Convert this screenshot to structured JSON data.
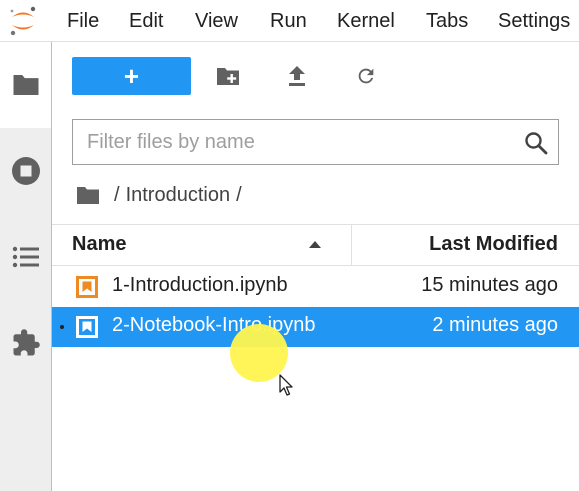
{
  "menubar": {
    "items": [
      "File",
      "Edit",
      "View",
      "Run",
      "Kernel",
      "Tabs",
      "Settings"
    ]
  },
  "sidebar": {
    "tabs": [
      {
        "icon": "folder-icon",
        "active": true
      },
      {
        "icon": "stop-circle-icon",
        "active": false
      },
      {
        "icon": "list-icon",
        "active": false
      },
      {
        "icon": "extension-puzzle-icon",
        "active": false
      }
    ]
  },
  "toolbar": {
    "new_launcher_label": "+",
    "icons": [
      "new-folder-icon",
      "upload-icon",
      "refresh-icon"
    ]
  },
  "filter": {
    "placeholder": "Filter files by name",
    "value": ""
  },
  "breadcrumbs": {
    "separator": "/",
    "path": [
      "Introduction"
    ]
  },
  "file_list": {
    "columns": {
      "name": "Name",
      "modified": "Last Modified"
    },
    "sort": "name-ascending",
    "rows": [
      {
        "name": "1-Introduction.ipynb",
        "modified": "15 minutes ago",
        "selected": false,
        "running": false
      },
      {
        "name": "2-Notebook-Intro.ipynb",
        "modified": "2 minutes ago",
        "selected": true,
        "running": true
      }
    ]
  },
  "colors": {
    "accent": "#2196f3",
    "notebook_icon": "#ef8a22",
    "cursor_highlight": "#fff44f"
  }
}
